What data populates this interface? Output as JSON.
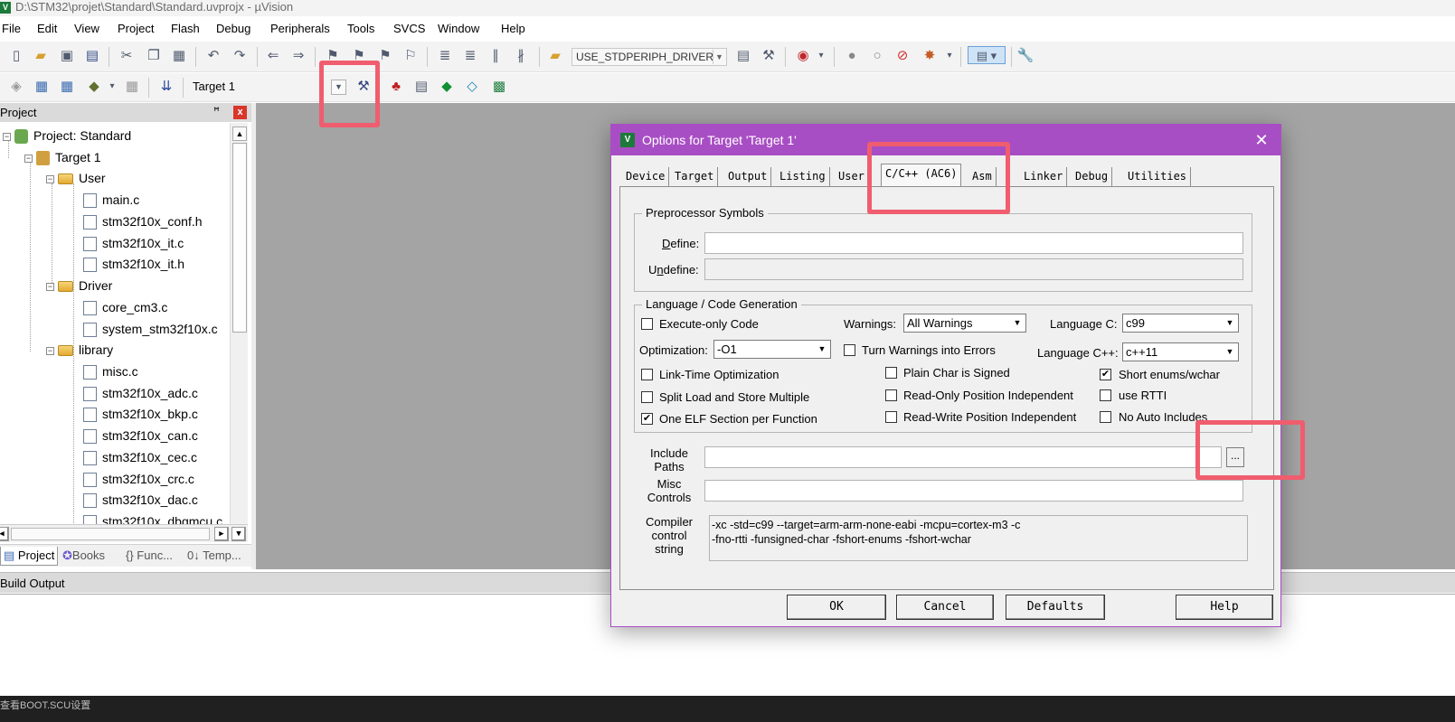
{
  "window": {
    "title": "D:\\STM32\\projet\\Standard\\Standard.uvprojx - µVision",
    "app_icon": "V"
  },
  "menu": [
    "File",
    "Edit",
    "View",
    "Project",
    "Flash",
    "Debug",
    "Peripherals",
    "Tools",
    "SVCS",
    "Window",
    "Help"
  ],
  "toolbar": {
    "define_combo": "USE_STDPERIPH_DRIVER",
    "target_combo": "Target 1"
  },
  "project_panel": {
    "title": "Project",
    "pin": "ꟸ",
    "close": "x",
    "tree": [
      {
        "label": "Project: Standard",
        "level": 0,
        "kind": "project",
        "expander": "−"
      },
      {
        "label": "Target 1",
        "level": 1,
        "kind": "target",
        "expander": "−"
      },
      {
        "label": "User",
        "level": 2,
        "kind": "folder",
        "expander": "−"
      },
      {
        "label": "main.c",
        "level": 3,
        "kind": "file"
      },
      {
        "label": "stm32f10x_conf.h",
        "level": 3,
        "kind": "file"
      },
      {
        "label": "stm32f10x_it.c",
        "level": 3,
        "kind": "file"
      },
      {
        "label": "stm32f10x_it.h",
        "level": 3,
        "kind": "file"
      },
      {
        "label": "Driver",
        "level": 2,
        "kind": "folder",
        "expander": "−"
      },
      {
        "label": "core_cm3.c",
        "level": 3,
        "kind": "file"
      },
      {
        "label": "system_stm32f10x.c",
        "level": 3,
        "kind": "file"
      },
      {
        "label": "library",
        "level": 2,
        "kind": "folder",
        "expander": "−"
      },
      {
        "label": "misc.c",
        "level": 3,
        "kind": "file"
      },
      {
        "label": "stm32f10x_adc.c",
        "level": 3,
        "kind": "file"
      },
      {
        "label": "stm32f10x_bkp.c",
        "level": 3,
        "kind": "file"
      },
      {
        "label": "stm32f10x_can.c",
        "level": 3,
        "kind": "file"
      },
      {
        "label": "stm32f10x_cec.c",
        "level": 3,
        "kind": "file"
      },
      {
        "label": "stm32f10x_crc.c",
        "level": 3,
        "kind": "file"
      },
      {
        "label": "stm32f10x_dac.c",
        "level": 3,
        "kind": "file"
      },
      {
        "label": "stm32f10x_dbgmcu.c",
        "level": 3,
        "kind": "file"
      }
    ],
    "tabs": [
      "Project",
      "Books",
      "{} Func...",
      "0↓ Temp..."
    ]
  },
  "build_output": {
    "title": "Build Output",
    "taskbar_text": "查看BOOT.SCU设置"
  },
  "dialog": {
    "title": "Options for Target 'Target 1'",
    "close": "✕",
    "tabs": [
      "Device",
      "Target",
      "Output",
      "Listing",
      "User",
      "C/C++ (AC6)",
      "Asm",
      "Linker",
      "Debug",
      "Utilities"
    ],
    "active_tab": "C/C++ (AC6)",
    "preprocessor": {
      "group": "Preprocessor Symbols",
      "define_label": "Define:",
      "define_value": "",
      "undefine_label": "Undefine:",
      "undefine_value": ""
    },
    "language": {
      "group": "Language / Code Generation",
      "execute_only": {
        "label": "Execute-only Code",
        "checked": false
      },
      "warnings_label": "Warnings:",
      "warnings_value": "All Warnings",
      "language_c_label": "Language C:",
      "language_c_value": "c99",
      "optimization_label": "Optimization:",
      "optimization_value": "-O1",
      "turn_warnings": {
        "label": "Turn Warnings into Errors",
        "checked": false
      },
      "language_cpp_label": "Language C++:",
      "language_cpp_value": "c++11",
      "lto": {
        "label": "Link-Time Optimization",
        "checked": false
      },
      "plain_char": {
        "label": "Plain Char is Signed",
        "checked": false
      },
      "short_enums": {
        "label": "Short enums/wchar",
        "checked": true
      },
      "split_load": {
        "label": "Split Load and Store Multiple",
        "checked": false
      },
      "ropi": {
        "label": "Read-Only Position Independent",
        "checked": false
      },
      "rtti": {
        "label": "use RTTI",
        "checked": false
      },
      "one_elf": {
        "label": "One ELF Section per Function",
        "checked": true
      },
      "rwpi": {
        "label": "Read-Write Position Independent",
        "checked": false
      },
      "no_auto": {
        "label": "No Auto Includes",
        "checked": false
      }
    },
    "include_paths_label": "Include Paths",
    "include_paths_value": "",
    "browse_label": "...",
    "misc_controls_label": "Misc Controls",
    "misc_controls_value": "",
    "compiler_string_label": "Compiler control string",
    "compiler_string_line1": "-xc -std=c99 --target=arm-arm-none-eabi -mcpu=cortex-m3 -c",
    "compiler_string_line2": "-fno-rtti -funsigned-char -fshort-enums -fshort-wchar",
    "buttons": {
      "ok": "OK",
      "cancel": "Cancel",
      "defaults": "Defaults",
      "help": "Help"
    }
  },
  "colors": {
    "dialog_title": "#a84ec4",
    "highlight": "#f05d6e",
    "editor_bg": "#a4a4a4"
  }
}
